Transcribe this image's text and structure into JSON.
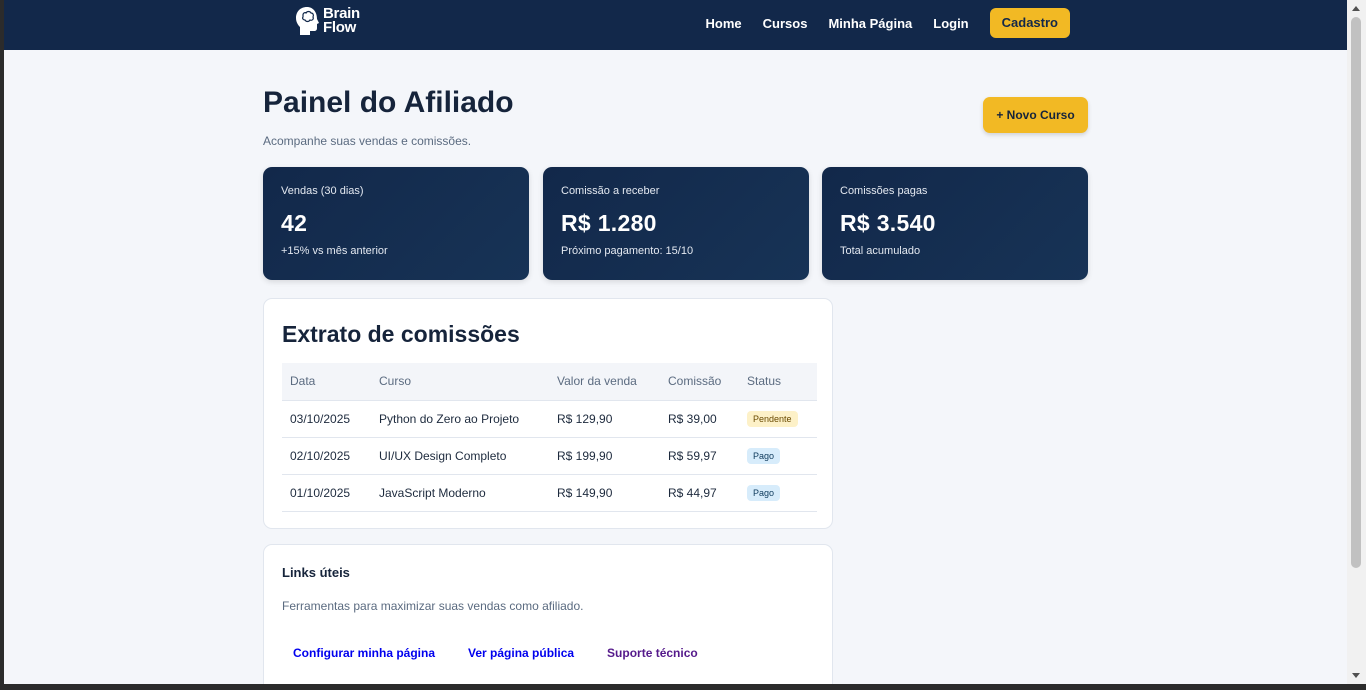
{
  "brand": {
    "line1": "Brain",
    "line2": "Flow"
  },
  "nav": {
    "items": [
      "Home",
      "Cursos",
      "Minha Página",
      "Login"
    ],
    "cta": "Cadastro"
  },
  "header": {
    "title": "Painel do Afiliado",
    "subtitle": "Acompanhe suas vendas e comissões.",
    "new_course_button": "+ Novo Curso"
  },
  "stats": [
    {
      "label": "Vendas (30 dias)",
      "value": "42",
      "note": "+15% vs mês anterior"
    },
    {
      "label": "Comissão a receber",
      "value": "R$ 1.280",
      "note": "Próximo pagamento: 15/10"
    },
    {
      "label": "Comissões pagas",
      "value": "R$ 3.540",
      "note": "Total acumulado"
    }
  ],
  "statement": {
    "title": "Extrato de comissões",
    "columns": [
      "Data",
      "Curso",
      "Valor da venda",
      "Comissão",
      "Status"
    ],
    "rows": [
      {
        "date": "03/10/2025",
        "course": "Python do Zero ao Projeto",
        "sale": "R$ 129,90",
        "commission": "R$ 39,00",
        "status": "Pendente"
      },
      {
        "date": "02/10/2025",
        "course": "UI/UX Design Completo",
        "sale": "R$ 199,90",
        "commission": "R$ 59,97",
        "status": "Pago"
      },
      {
        "date": "01/10/2025",
        "course": "JavaScript Moderno",
        "sale": "R$ 149,90",
        "commission": "R$ 44,97",
        "status": "Pago"
      }
    ]
  },
  "links_panel": {
    "title": "Links úteis",
    "description": "Ferramentas para maximizar suas vendas como afiliado.",
    "links": [
      "Configurar minha página",
      "Ver página pública",
      "Suporte técnico"
    ]
  },
  "colors": {
    "navy": "#12284a",
    "accent": "#f2b924",
    "pending_badge": "#fdf1c8",
    "paid_badge": "#d7ecfb"
  },
  "icons": {
    "logo": "brain-head-icon"
  }
}
